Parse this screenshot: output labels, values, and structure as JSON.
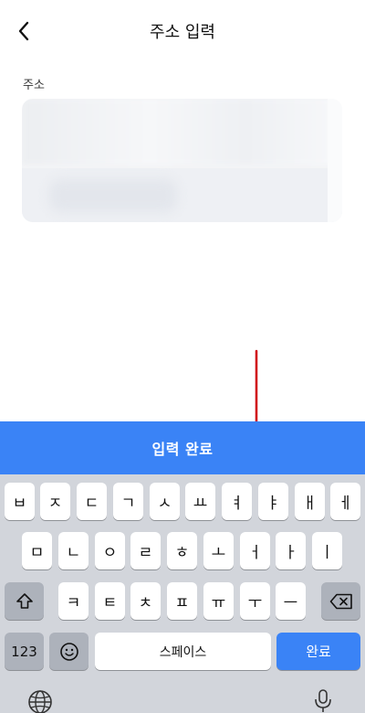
{
  "header": {
    "title": "주소 입력",
    "back_icon": "chevron-left-icon"
  },
  "address": {
    "label": "주소",
    "line1": "",
    "line2": ""
  },
  "complete_button": {
    "label": "입력 완료",
    "color": "#3a83f6"
  },
  "annotation": {
    "arrow_color": "#d0101a"
  },
  "keyboard": {
    "row1": [
      "ㅂ",
      "ㅈ",
      "ㄷ",
      "ㄱ",
      "ㅅ",
      "ㅛ",
      "ㅕ",
      "ㅑ",
      "ㅐ",
      "ㅔ"
    ],
    "row2": [
      "ㅁ",
      "ㄴ",
      "ㅇ",
      "ㄹ",
      "ㅎ",
      "ㅗ",
      "ㅓ",
      "ㅏ",
      "ㅣ"
    ],
    "row3": [
      "ㅋ",
      "ㅌ",
      "ㅊ",
      "ㅍ",
      "ㅠ",
      "ㅜ",
      "ㅡ"
    ],
    "numbers_label": "123",
    "space_label": "스페이스",
    "return_label": "완료",
    "shift_icon": "shift-icon",
    "delete_icon": "backspace-icon",
    "emoji_icon": "emoji-icon",
    "globe_icon": "globe-icon",
    "mic_icon": "microphone-icon"
  }
}
